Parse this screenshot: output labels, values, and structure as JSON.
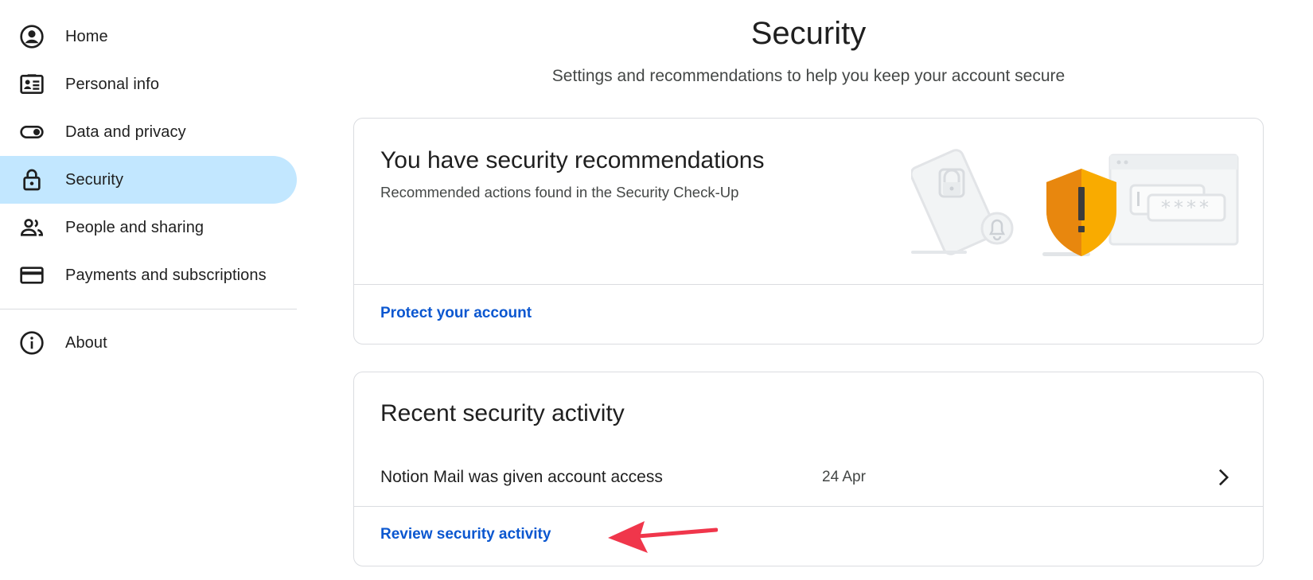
{
  "sidebar": {
    "items": [
      {
        "label": "Home",
        "icon": "account-circle-icon"
      },
      {
        "label": "Personal info",
        "icon": "id-card-icon"
      },
      {
        "label": "Data and privacy",
        "icon": "toggle-icon"
      },
      {
        "label": "Security",
        "icon": "lock-icon",
        "active": true
      },
      {
        "label": "People and sharing",
        "icon": "people-icon"
      },
      {
        "label": "Payments and subscriptions",
        "icon": "credit-card-icon"
      }
    ],
    "footer": [
      {
        "label": "About",
        "icon": "info-icon"
      }
    ]
  },
  "header": {
    "title": "Security",
    "subtitle": "Settings and recommendations to help you keep your account secure"
  },
  "recommendations_card": {
    "title": "You have security recommendations",
    "description": "Recommended actions found in the Security Check-Up",
    "link": "Protect your account",
    "illustration": {
      "password_mask": "****"
    }
  },
  "activity_card": {
    "title": "Recent security activity",
    "items": [
      {
        "description": "Notion Mail was given account access",
        "date": "24 Apr"
      }
    ],
    "link": "Review security activity"
  },
  "colors": {
    "accent_link": "#0b57d0",
    "active_nav_bg": "#c2e7ff",
    "warning_shield": "#f9ab00",
    "annotation_arrow": "#f0364b"
  }
}
